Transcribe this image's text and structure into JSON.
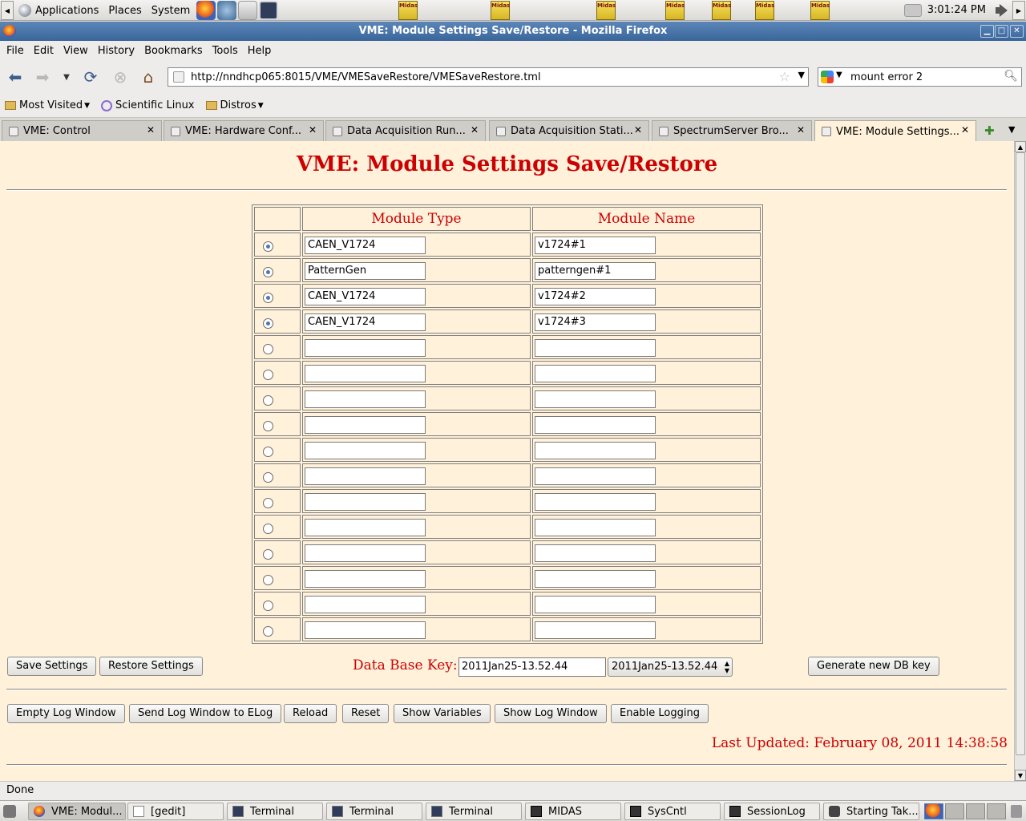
{
  "panel": {
    "menus": [
      "Applications",
      "Places",
      "System"
    ],
    "clock": "3:01:24 PM",
    "midas_label": "Midas"
  },
  "window": {
    "title": "VME: Module Settings Save/Restore - Mozilla Firefox"
  },
  "menubar": {
    "items": [
      {
        "label": "File",
        "key": "F"
      },
      {
        "label": "Edit",
        "key": "E"
      },
      {
        "label": "View",
        "key": "V"
      },
      {
        "label": "History",
        "key": "s"
      },
      {
        "label": "Bookmarks",
        "key": "B"
      },
      {
        "label": "Tools",
        "key": "T"
      },
      {
        "label": "Help",
        "key": "H"
      }
    ]
  },
  "navbar": {
    "url": "http://nndhcp065:8015/VME/VMESaveRestore/VMESaveRestore.tml",
    "search": "mount error 2"
  },
  "bookmarks": [
    "Most Visited",
    "Scientific Linux",
    "Distros"
  ],
  "tabs": [
    "VME: Control",
    "VME: Hardware Conf...",
    "Data Acquisition Run...",
    "Data Acquisition Stati...",
    "SpectrumServer Bro...",
    "VME: Module Settings..."
  ],
  "page": {
    "title": "VME: Module Settings Save/Restore",
    "headers": {
      "type": "Module Type",
      "name": "Module Name"
    },
    "rows": [
      {
        "selected": true,
        "type": "CAEN_V1724",
        "name": "v1724#1"
      },
      {
        "selected": true,
        "type": "PatternGen",
        "name": "patterngen#1"
      },
      {
        "selected": true,
        "type": "CAEN_V1724",
        "name": "v1724#2"
      },
      {
        "selected": true,
        "type": "CAEN_V1724",
        "name": "v1724#3"
      },
      {
        "selected": false,
        "type": "",
        "name": ""
      },
      {
        "selected": false,
        "type": "",
        "name": ""
      },
      {
        "selected": false,
        "type": "",
        "name": ""
      },
      {
        "selected": false,
        "type": "",
        "name": ""
      },
      {
        "selected": false,
        "type": "",
        "name": ""
      },
      {
        "selected": false,
        "type": "",
        "name": ""
      },
      {
        "selected": false,
        "type": "",
        "name": ""
      },
      {
        "selected": false,
        "type": "",
        "name": ""
      },
      {
        "selected": false,
        "type": "",
        "name": ""
      },
      {
        "selected": false,
        "type": "",
        "name": ""
      },
      {
        "selected": false,
        "type": "",
        "name": ""
      },
      {
        "selected": false,
        "type": "",
        "name": ""
      }
    ],
    "save_label": "Save Settings",
    "restore_label": "Restore Settings",
    "dbkey_label": "Data Base Key:",
    "dbkey_value": "2011Jan25-13.52.44",
    "dbkey_selected": "2011Jan25-13.52.44",
    "generate_label": "Generate new DB key",
    "log_buttons": [
      "Empty Log Window",
      "Send Log Window to ELog",
      "Reload",
      "Reset",
      "Show Variables",
      "Show Log Window",
      "Enable Logging"
    ],
    "last_updated": "Last Updated: February 08, 2011 14:38:58",
    "accent": "#cc0000",
    "background": "#fff1da"
  },
  "status": "Done",
  "taskbar": [
    {
      "label": "VME: Modul...",
      "icon": "firefox-icon",
      "active": true
    },
    {
      "label": "[gedit]",
      "icon": "gedit-icon",
      "active": false
    },
    {
      "label": "Terminal",
      "icon": "terminal-icon",
      "active": false
    },
    {
      "label": "Terminal",
      "icon": "terminal-icon",
      "active": false
    },
    {
      "label": "Terminal",
      "icon": "terminal-icon",
      "active": false
    },
    {
      "label": "MIDAS",
      "icon": "app-icon",
      "active": false
    },
    {
      "label": "SysCntl",
      "icon": "app-icon",
      "active": false
    },
    {
      "label": "SessionLog",
      "icon": "app-icon",
      "active": false
    },
    {
      "label": "Starting Tak...",
      "icon": "camera-icon",
      "active": false
    }
  ]
}
